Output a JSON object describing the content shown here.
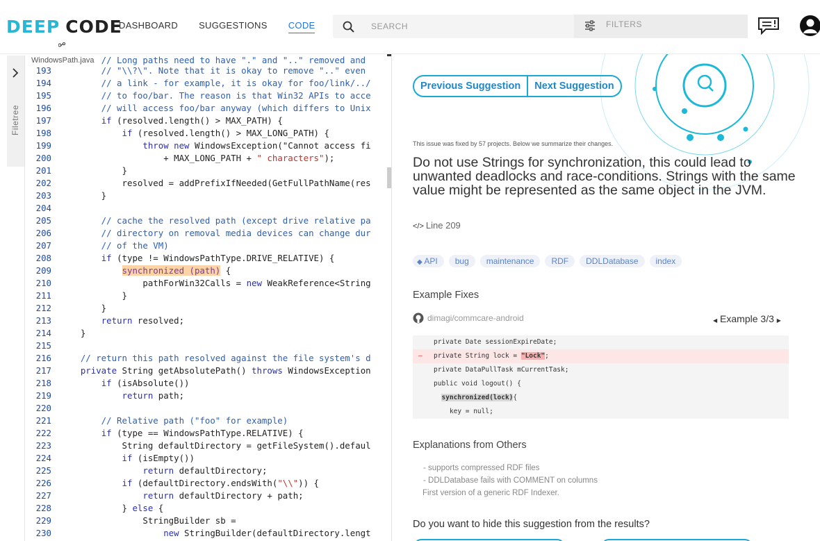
{
  "logo": {
    "deep": "DEEP",
    "code": "CODE"
  },
  "nav": {
    "items": [
      "DASHBOARD",
      "SUGGESTIONS",
      "CODE"
    ],
    "active_index": 2
  },
  "search": {
    "placeholder": "SEARCH",
    "filters_placeholder": "FILTERS"
  },
  "sidebar": {
    "filetree_label": "Filetree"
  },
  "code": {
    "filename": "WindowsPath.java",
    "lines": [
      {
        "n": "193",
        "t": "        // \"\\\\?\\\". Note that it is okay to remove \"..\" even"
      },
      {
        "n": "194",
        "t": "        // a link - for example, it is okay for foo/link/../"
      },
      {
        "n": "195",
        "t": "        // to foo/bar. The reason is that Win32 APIs to acce"
      },
      {
        "n": "196",
        "t": "        // will access foo/bar anyway (which differs to Unix"
      },
      {
        "n": "197",
        "t": "        if (resolved.length() > MAX_PATH) {"
      },
      {
        "n": "198",
        "t": "            if (resolved.length() > MAX_LONG_PATH) {"
      },
      {
        "n": "199",
        "t": "                throw new WindowsException(\"Cannot access fi"
      },
      {
        "n": "200",
        "t": "                    + MAX_LONG_PATH + \" characters\");"
      },
      {
        "n": "201",
        "t": "            }"
      },
      {
        "n": "202",
        "t": "            resolved = addPrefixIfNeeded(GetFullPathName(res"
      },
      {
        "n": "203",
        "t": "        }"
      },
      {
        "n": "204",
        "t": ""
      },
      {
        "n": "205",
        "t": "        // cache the resolved path (except drive relative pa"
      },
      {
        "n": "206",
        "t": "        // directory on removal media devices can change dur"
      },
      {
        "n": "207",
        "t": "        // of the VM)"
      },
      {
        "n": "208",
        "t": "        if (type != WindowsPathType.DRIVE_RELATIVE) {"
      },
      {
        "n": "209",
        "t": "            synchronized (path) {"
      },
      {
        "n": "210",
        "t": "                pathForWin32Calls = new WeakReference<String"
      },
      {
        "n": "211",
        "t": "            }"
      },
      {
        "n": "212",
        "t": "        }"
      },
      {
        "n": "213",
        "t": "        return resolved;"
      },
      {
        "n": "214",
        "t": "    }"
      },
      {
        "n": "215",
        "t": ""
      },
      {
        "n": "216",
        "t": "    // return this path resolved against the file system's d"
      },
      {
        "n": "217",
        "t": "    private String getAbsolutePath() throws WindowsException"
      },
      {
        "n": "218",
        "t": "        if (isAbsolute())"
      },
      {
        "n": "219",
        "t": "            return path;"
      },
      {
        "n": "220",
        "t": ""
      },
      {
        "n": "221",
        "t": "        // Relative path (\"foo\" for example)"
      },
      {
        "n": "222",
        "t": "        if (type == WindowsPathType.RELATIVE) {"
      },
      {
        "n": "223",
        "t": "            String defaultDirectory = getFileSystem().defaul"
      },
      {
        "n": "224",
        "t": "            if (isEmpty())"
      },
      {
        "n": "225",
        "t": "                return defaultDirectory;"
      },
      {
        "n": "226",
        "t": "            if (defaultDirectory.endsWith(\"\\\\\")) {"
      },
      {
        "n": "227",
        "t": "                return defaultDirectory + path;"
      },
      {
        "n": "228",
        "t": "            } else {"
      },
      {
        "n": "229",
        "t": "                StringBuilder sb ="
      },
      {
        "n": "230",
        "t": "                    new StringBuilder(defaultDirectory.lengt"
      }
    ],
    "top_partial": "        // Long paths need to have \".\" and \"..\" removed and"
  },
  "suggestion": {
    "prev_label": "Previous Suggestion",
    "next_label": "Next Suggestion",
    "fixed_note": "This issue was fixed by 57 projects. Below we summarize their changes.",
    "title": "Do not use Strings for synchronization, this could lead to unwanted deadlocks and race-conditions. Strings with the same value might be represented as the same object in the JVM.",
    "line_ref": "Line 209",
    "tags": [
      "API",
      "bug",
      "maintenance",
      "RDF",
      "DDLDatabase",
      "index"
    ],
    "example_fixes_title": "Example Fixes",
    "repo": "dimagi/commcare-android",
    "example_counter": "Example 3/3",
    "snippet": {
      "l1": "private Date sessionExpireDate;",
      "l2_pre": "private String lock = ",
      "l2_str": "\"Lock\"",
      "l2_post": ";",
      "l3": "private DataPullTask mCurrentTask;",
      "l4": "public void logout() {",
      "l5_sync": "synchronized(lock)",
      "l5_post": "{",
      "l6": "key = null;"
    },
    "explanations_title": "Explanations from Others",
    "explanations": [
      "- supports compressed RDF files",
      "- DDLDatabase fails with COMMENT on columns",
      "First version of a generic RDF Indexer."
    ],
    "hide_question": "Do you want to hide this suggestion from the results?"
  },
  "colors": {
    "accent": "#1ba8d6",
    "nav_active": "#2575d8",
    "highlight": "#fbd3a6"
  }
}
